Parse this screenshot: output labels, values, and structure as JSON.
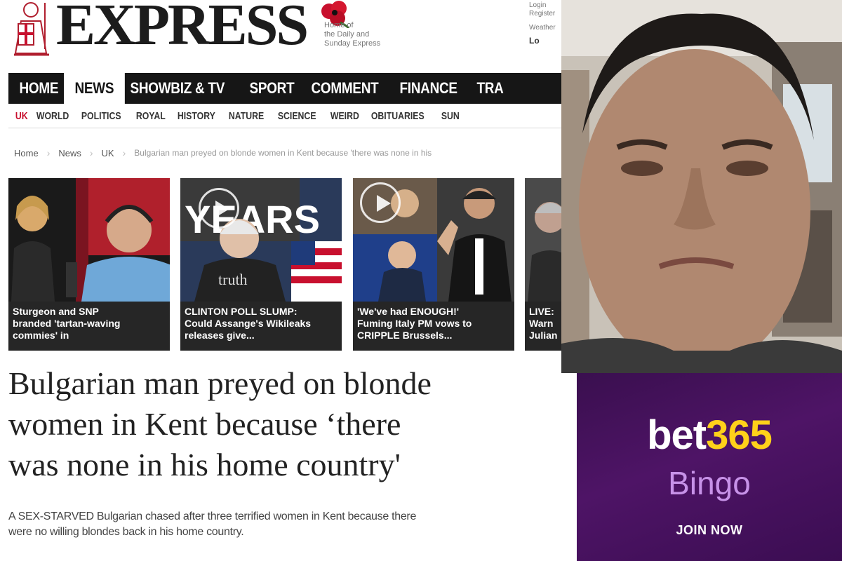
{
  "masthead": {
    "brand": "EXPRESS",
    "tagline": [
      "Home of",
      "the Daily and",
      "Sunday Express"
    ],
    "top_links": {
      "login": "Login",
      "register": "Register",
      "weather": "Weather",
      "location": "Lo"
    }
  },
  "main_nav": {
    "items": [
      "HOME",
      "NEWS",
      "SHOWBIZ & TV",
      "SPORT",
      "COMMENT",
      "FINANCE",
      "TRA"
    ],
    "active": "NEWS"
  },
  "sub_nav": {
    "items": [
      "UK",
      "WORLD",
      "POLITICS",
      "ROYAL",
      "HISTORY",
      "NATURE",
      "SCIENCE",
      "WEIRD",
      "OBITUARIES",
      "SUN"
    ],
    "active": "UK"
  },
  "breadcrumb": {
    "home": "Home",
    "section": "News",
    "subsection": "UK",
    "current": "Bulgarian man preyed on blonde women in Kent because 'there was none in his"
  },
  "cards": [
    {
      "lines": [
        "Sturgeon and SNP",
        "branded 'tartan-waving",
        "commies' in"
      ]
    },
    {
      "lines": [
        "CLINTON POLL SLUMP:",
        "Could Assange's Wikileaks",
        "releases give..."
      ],
      "photo_text": "YEARS",
      "shirt_text": "truth"
    },
    {
      "lines": [
        "'We've had ENOUGH!'",
        "Fuming Italy PM vows to",
        "CRIPPLE Brussels..."
      ]
    },
    {
      "lines": [
        "LIVE:",
        "Warn",
        "Julian"
      ]
    }
  ],
  "article": {
    "headline_lines": [
      "Bulgarian man preyed on blonde",
      "women in Kent because ‘there",
      "was none in his home country'"
    ],
    "standfirst_lines": [
      "A SEX-STARVED Bulgarian chased after three terrified women in Kent because there",
      "were no willing blondes back in his home country."
    ]
  },
  "ad": {
    "brand_part1": "bet",
    "brand_part2": "365",
    "product": "Bingo",
    "cta": "JOIN NOW"
  },
  "colors": {
    "nav_bg": "#161616",
    "accent_red": "#c8102e",
    "ad_purple": "#4e1466",
    "ad_yellow": "#ffd11a",
    "ad_lilac": "#c792e8"
  }
}
